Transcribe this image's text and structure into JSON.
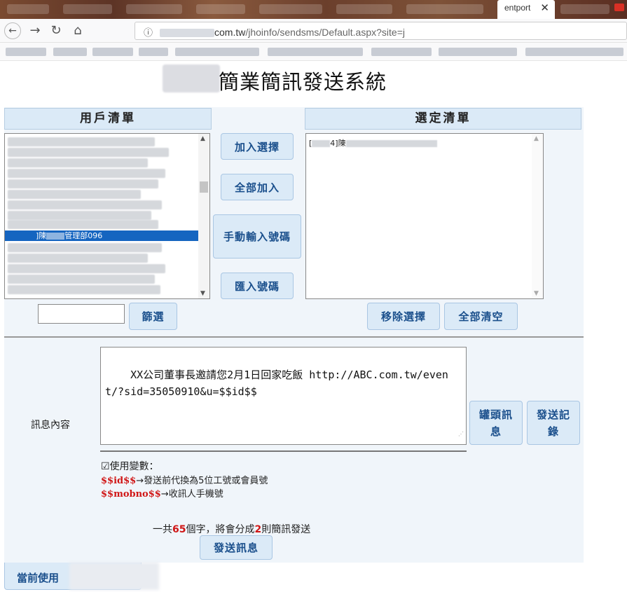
{
  "browser": {
    "active_tab_title": "entport",
    "tab_close": "✕",
    "url_domain_suffix": "com.tw",
    "url_path": "/jhoinfo/sendsms/Default.aspx?site=j"
  },
  "page": {
    "title": "簡業簡訊發送系統"
  },
  "user_list": {
    "header": "用戶清單",
    "selected_item_prefix": "]陳",
    "selected_item_suffix": "管理部096"
  },
  "selected_list": {
    "header": "選定清單",
    "item_prefix": "[",
    "item_mid": "4]陳"
  },
  "buttons": {
    "add_selected": "加入選擇",
    "add_all": "全部加入",
    "manual_input": "手動輸入號碼",
    "import_numbers": "匯入號碼",
    "filter": "篩選",
    "remove_selected": "移除選擇",
    "clear_all": "全部清空",
    "header_message": "罐頭訊息",
    "send_history": "發送記錄",
    "send_message": "發送訊息"
  },
  "message": {
    "label": "訊息內容",
    "content": "XX公司董事長邀請您2月1日回家吃飯 http://ABC.com.tw/event/?sid=35050910&u=$$id$$"
  },
  "variables": {
    "checkbox_label": "☑使用變數：",
    "var1_token": "$$id$$",
    "var1_desc": "→發送前代換為5位工號或會員號",
    "var2_token": "$$mobno$$",
    "var2_desc": "→收訊人手機號"
  },
  "counter": {
    "prefix": "一共",
    "char_count": "65",
    "middle": "個字，將會分成",
    "sms_count": "2",
    "suffix": "則簡訊發送"
  },
  "footer": {
    "current_user_label": "當前使用"
  }
}
